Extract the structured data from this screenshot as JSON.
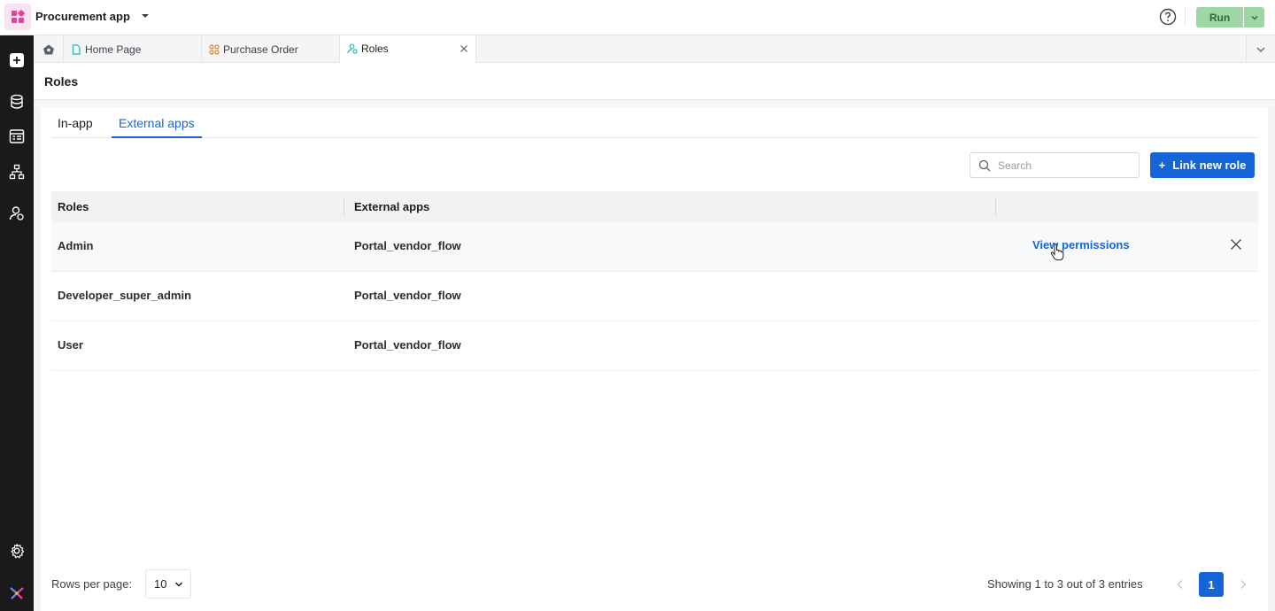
{
  "app": {
    "name": "Procurement app",
    "run_label": "Run"
  },
  "rail": {
    "items": [
      "add-icon",
      "database-icon",
      "queries-icon",
      "workflow-icon",
      "roles-icon",
      "settings-icon",
      "brand-logo-icon"
    ]
  },
  "tabs": [
    {
      "label": "Home Page",
      "icon": "page-icon"
    },
    {
      "label": "Purchase Order",
      "icon": "workflow-icon"
    },
    {
      "label": "Roles",
      "icon": "roles-icon",
      "active": true
    }
  ],
  "page": {
    "title": "Roles"
  },
  "subtabs": [
    {
      "label": "In-app"
    },
    {
      "label": "External apps",
      "active": true
    }
  ],
  "search": {
    "placeholder": "Search",
    "value": ""
  },
  "link_button": {
    "icon": "+",
    "label": "Link new role"
  },
  "table": {
    "columns": [
      "Roles",
      "External apps"
    ],
    "rows": [
      {
        "role": "Admin",
        "external_app": "Portal_vendor_flow",
        "action": "View permissions"
      },
      {
        "role": "Developer_super_admin",
        "external_app": "Portal_vendor_flow"
      },
      {
        "role": "User",
        "external_app": "Portal_vendor_flow"
      }
    ]
  },
  "footer": {
    "rows_per_page_label": "Rows per page:",
    "rows_per_page_value": "10",
    "entries_text": "Showing 1 to 3 out of 3 entries",
    "current_page": "1"
  },
  "colors": {
    "accent": "#1565d8",
    "run_button": "#9fd6a6",
    "rail": "#1a1a1d"
  }
}
